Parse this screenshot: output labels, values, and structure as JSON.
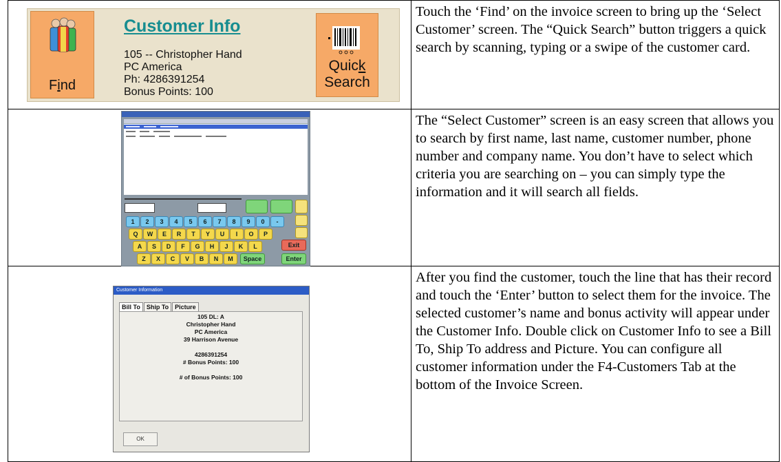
{
  "customer_panel": {
    "title": "Customer Info",
    "lines": [
      "105 -- Christopher Hand",
      "PC America",
      "Ph: 4286391254",
      "Bonus Points: 100"
    ],
    "find_button": {
      "label_pre": "F",
      "label_ul": "i",
      "label_post": "nd"
    },
    "quick_search_button": {
      "line1_pre": "Quic",
      "line1_ul": "k",
      "line2": "Search"
    }
  },
  "keypad": {
    "numbers": [
      "1",
      "2",
      "3",
      "4",
      "5",
      "6",
      "7",
      "8",
      "9",
      "0",
      "-"
    ],
    "row_q": [
      "Q",
      "W",
      "E",
      "R",
      "T",
      "Y",
      "U",
      "I",
      "O",
      "P"
    ],
    "row_a": [
      "A",
      "S",
      "D",
      "F",
      "G",
      "H",
      "J",
      "K",
      "L"
    ],
    "row_z": [
      "Z",
      "X",
      "C",
      "V",
      "B",
      "N",
      "M"
    ],
    "space": "Space",
    "exit": "Exit",
    "enter": "Enter"
  },
  "customer_dialog": {
    "title": "Customer Information",
    "tabs": [
      "Bill To",
      "Ship To",
      "Picture"
    ],
    "body_lines": [
      "105  DL: A",
      "Christopher Hand",
      "PC America",
      "39 Harrison Avenue",
      "",
      "4286391254",
      "# Bonus Points: 100",
      "",
      "# of Bonus Points: 100"
    ],
    "ok": "OK"
  },
  "descriptions": [
    "Touch the ‘Find’ on the invoice screen to bring up the ‘Select Customer’ screen. The “Quick Search” button triggers a quick search by scanning, typing or a swipe of the customer card.",
    "The “Select Customer” screen is an easy screen that allows you to search by first name, last name, customer number, phone number and company name.  You don’t have to select which criteria you are searching on – you can simply type the information and it will search all fields.",
    "After you find the customer, touch the line that has their record and touch the ‘Enter’ button to select them for the invoice. The selected customer’s name and bonus activity will appear under the Customer Info. Double click on Customer Info to see a Bill To, Ship To address and Picture. You can configure all customer information under the F4-Customers Tab at the bottom of the Invoice Screen."
  ],
  "colors": {
    "title_teal": "#178d90",
    "button_orange": "#f6a967",
    "bar_beige": "#eae2cc"
  }
}
